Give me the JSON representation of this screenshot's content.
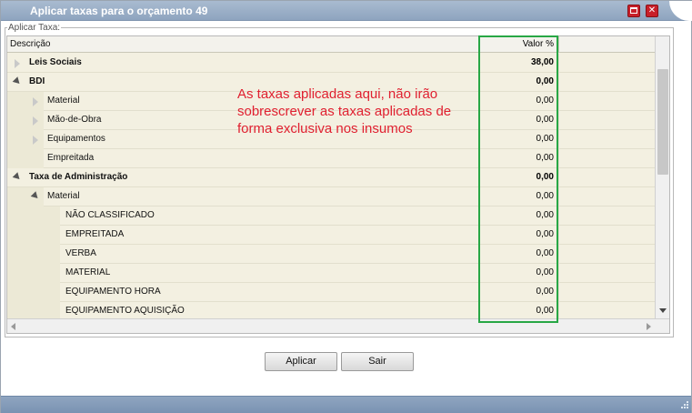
{
  "window": {
    "title": "Aplicar taxas para o orçamento 49"
  },
  "fieldset": {
    "legend": "Aplicar Taxa:"
  },
  "grid": {
    "headers": {
      "description": "Descrição",
      "value": "Valor %"
    },
    "rows": [
      {
        "label": "Leis Sociais",
        "value": "38,00",
        "bold": true,
        "level": 0,
        "expander": "closed"
      },
      {
        "label": "BDI",
        "value": "0,00",
        "bold": true,
        "level": 0,
        "expander": "open"
      },
      {
        "label": "Material",
        "value": "0,00",
        "bold": false,
        "level": 1,
        "expander": "closed"
      },
      {
        "label": "Mão-de-Obra",
        "value": "0,00",
        "bold": false,
        "level": 1,
        "expander": "closed"
      },
      {
        "label": "Equipamentos",
        "value": "0,00",
        "bold": false,
        "level": 1,
        "expander": "closed"
      },
      {
        "label": "Empreitada",
        "value": "0,00",
        "bold": false,
        "level": 1,
        "expander": "none"
      },
      {
        "label": "Taxa de Administração",
        "value": "0,00",
        "bold": true,
        "level": 0,
        "expander": "open"
      },
      {
        "label": "Material",
        "value": "0,00",
        "bold": false,
        "level": 1,
        "expander": "open"
      },
      {
        "label": "NÃO CLASSIFICADO",
        "value": "0,00",
        "bold": false,
        "level": 2,
        "expander": "none"
      },
      {
        "label": "EMPREITADA",
        "value": "0,00",
        "bold": false,
        "level": 2,
        "expander": "none"
      },
      {
        "label": "VERBA",
        "value": "0,00",
        "bold": false,
        "level": 2,
        "expander": "none"
      },
      {
        "label": "MATERIAL",
        "value": "0,00",
        "bold": false,
        "level": 2,
        "expander": "none"
      },
      {
        "label": "EQUIPAMENTO HORA",
        "value": "0,00",
        "bold": false,
        "level": 2,
        "expander": "none"
      },
      {
        "label": "EQUIPAMENTO AQUISIÇÃO",
        "value": "0,00",
        "bold": false,
        "level": 2,
        "expander": "none"
      }
    ]
  },
  "annotation": {
    "text": "As taxas aplicadas aqui, não irão sobrescrever as taxas aplicadas de forma exclusiva nos insumos",
    "color": "#e02030",
    "highlight_color": "#28a745"
  },
  "buttons": {
    "apply": "Aplicar",
    "exit": "Sair"
  },
  "icons": {
    "maximize": "maximize-icon",
    "close": "close-icon"
  }
}
